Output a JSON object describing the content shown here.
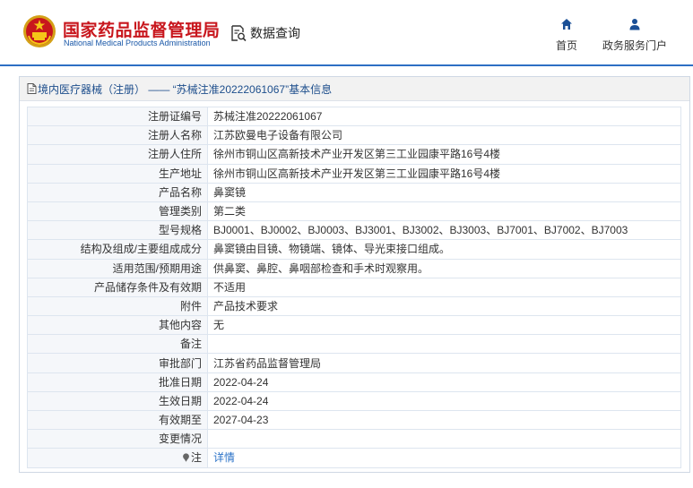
{
  "header": {
    "site_name_cn": "国家药品监督管理局",
    "site_name_en": "National Medical Products Administration",
    "query_label": "数据查询",
    "nav": {
      "home": "首页",
      "portal": "政务服务门户"
    }
  },
  "panel": {
    "title": "境内医疗器械（注册） —— “苏械注准20222061067”基本信息"
  },
  "rows": [
    {
      "label": "注册证编号",
      "value": "苏械注准20222061067"
    },
    {
      "label": "注册人名称",
      "value": "江苏欧曼电子设备有限公司"
    },
    {
      "label": "注册人住所",
      "value": "徐州市铜山区高新技术产业开发区第三工业园康平路16号4楼"
    },
    {
      "label": "生产地址",
      "value": "徐州市铜山区高新技术产业开发区第三工业园康平路16号4楼"
    },
    {
      "label": "产品名称",
      "value": "鼻窦镜"
    },
    {
      "label": "管理类别",
      "value": "第二类"
    },
    {
      "label": "型号规格",
      "value": "BJ0001、BJ0002、BJ0003、BJ3001、BJ3002、BJ3003、BJ7001、BJ7002、BJ7003"
    },
    {
      "label": "结构及组成/主要组成成分",
      "value": "鼻窦镜由目镜、物镜端、镜体、导光束接口组成。"
    },
    {
      "label": "适用范围/预期用途",
      "value": "供鼻窦、鼻腔、鼻咽部检查和手术时观察用。"
    },
    {
      "label": "产品储存条件及有效期",
      "value": "不适用"
    },
    {
      "label": "附件",
      "value": "产品技术要求"
    },
    {
      "label": "其他内容",
      "value": "无"
    },
    {
      "label": "备注",
      "value": ""
    },
    {
      "label": "审批部门",
      "value": "江苏省药品监督管理局"
    },
    {
      "label": "批准日期",
      "value": "2022-04-24"
    },
    {
      "label": "生效日期",
      "value": "2022-04-24"
    },
    {
      "label": "有效期至",
      "value": "2027-04-23"
    },
    {
      "label": "变更情况",
      "value": ""
    }
  ],
  "note_row": {
    "label": "注",
    "link": "详情",
    "icon": "pin-icon"
  },
  "colors": {
    "brand_red": "#c8161d",
    "brand_blue": "#1a58a8",
    "link": "#2b73c8",
    "title_text": "#1d4e8c"
  }
}
